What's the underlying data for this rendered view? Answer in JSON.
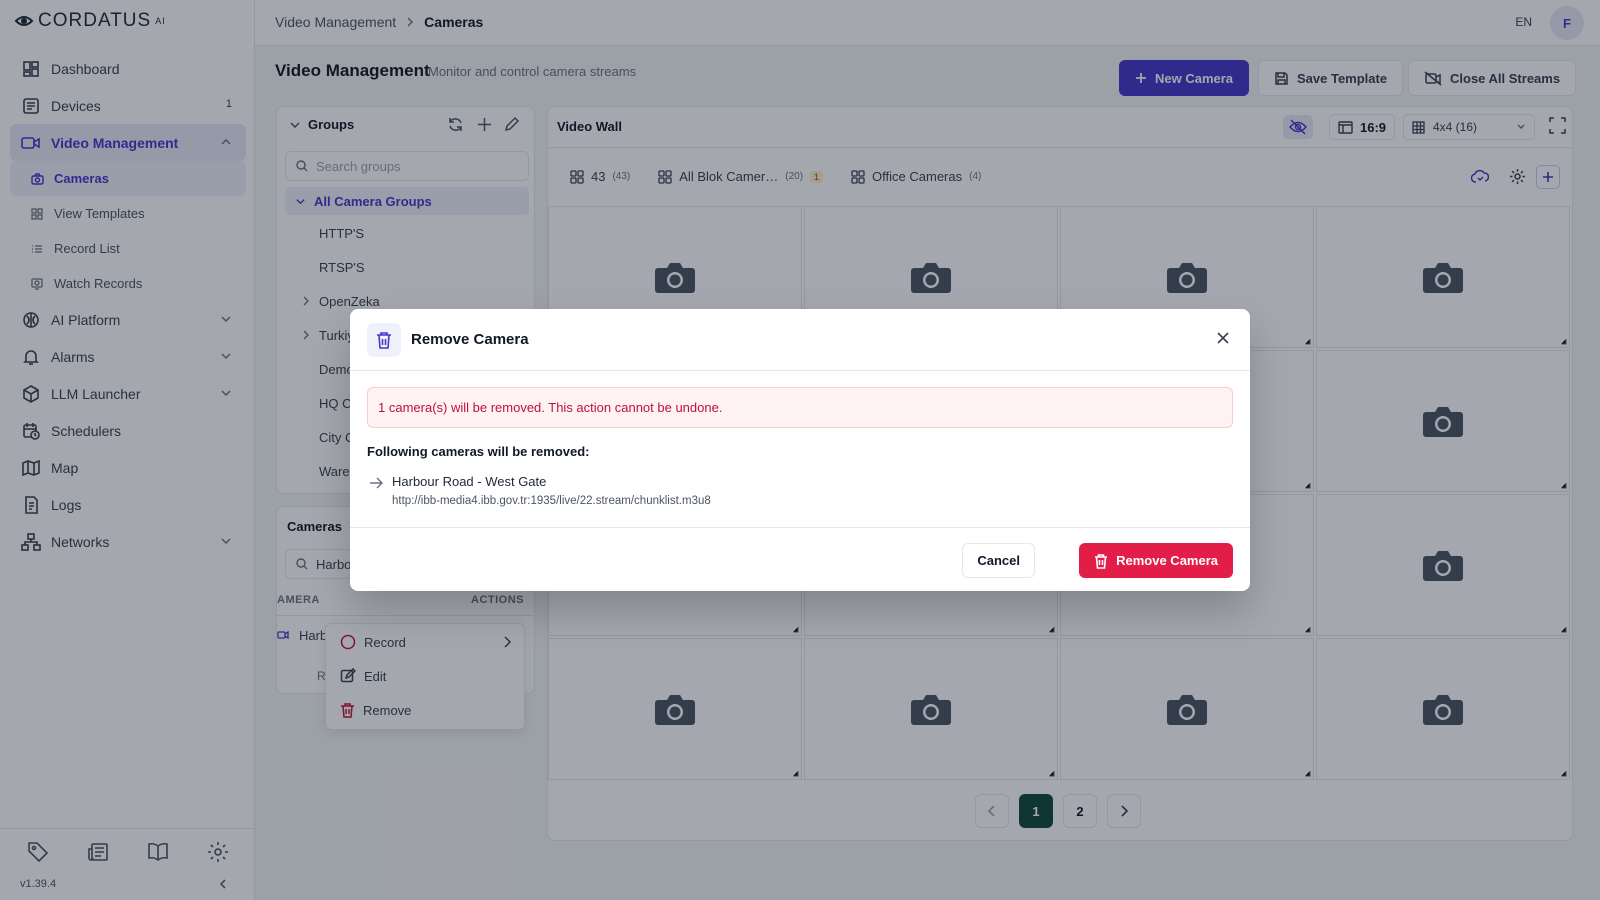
{
  "app": {
    "logo": "CORDATUS",
    "logo_sup": "AI",
    "version": "v1.39.4"
  },
  "sidebar": {
    "items": [
      {
        "label": "Dashboard",
        "icon": "dashboard-icon"
      },
      {
        "label": "Devices",
        "icon": "devices-icon",
        "badge": "1"
      },
      {
        "label": "Video Management",
        "icon": "video-icon"
      },
      {
        "label": "AI Platform",
        "icon": "brain-icon"
      },
      {
        "label": "Alarms",
        "icon": "bell-icon"
      },
      {
        "label": "LLM Launcher",
        "icon": "cube-icon"
      },
      {
        "label": "Schedulers",
        "icon": "calendar-clock-icon"
      },
      {
        "label": "Map",
        "icon": "map-icon"
      },
      {
        "label": "Logs",
        "icon": "logs-icon"
      },
      {
        "label": "Networks",
        "icon": "network-icon"
      }
    ],
    "video_sub": [
      {
        "label": "Cameras",
        "icon": "camera-icon"
      },
      {
        "label": "View Templates",
        "icon": "grid-icon"
      },
      {
        "label": "Record List",
        "icon": "list-icon"
      },
      {
        "label": "Watch Records",
        "icon": "record-icon"
      }
    ]
  },
  "topbar": {
    "crumb_parent": "Video Management",
    "crumb_current": "Cameras",
    "lang": "EN",
    "avatar": "F"
  },
  "page": {
    "title": "Video Management",
    "subtitle": "Monitor and control camera streams",
    "new_camera": "New Camera",
    "save_template": "Save Template",
    "close_streams": "Close All Streams"
  },
  "groups": {
    "title": "Groups",
    "search_placeholder": "Search groups",
    "items": [
      "All Camera Groups",
      "HTTP'S",
      "RTSP'S",
      "OpenZeka",
      "Turkiy",
      "Demo",
      "HQ C",
      "City C",
      "Warel"
    ]
  },
  "cameras_panel": {
    "title": "Cameras",
    "search_value": "Harbo",
    "col_camera": "AMERA",
    "col_actions": "ACTIONS",
    "row_label": "Harb",
    "row2_label": "R"
  },
  "context_menu": {
    "record": "Record",
    "edit": "Edit",
    "remove": "Remove"
  },
  "video_wall": {
    "title": "Video Wall",
    "ratio": "16:9",
    "layout": "4x4 (16)",
    "tabs": [
      {
        "label": "43",
        "count": "(43)"
      },
      {
        "label": "All Blok Camer…",
        "count": "(20)",
        "badge": "1"
      },
      {
        "label": "Office Cameras",
        "count": "(4)"
      }
    ],
    "pages": [
      "1",
      "2"
    ],
    "current_page": "1"
  },
  "modal": {
    "title": "Remove Camera",
    "warning": "1 camera(s) will be removed. This action cannot be undone.",
    "list_title": "Following cameras will be removed:",
    "camera_name": "Harbour Road - West Gate",
    "camera_url": "http://ibb-media4.ibb.gov.tr:1935/live/22.stream/chunklist.m3u8",
    "cancel": "Cancel",
    "confirm": "Remove Camera"
  },
  "colors": {
    "primary": "#4338ca",
    "danger": "#e11d48",
    "active_page": "#0f4a3d"
  }
}
